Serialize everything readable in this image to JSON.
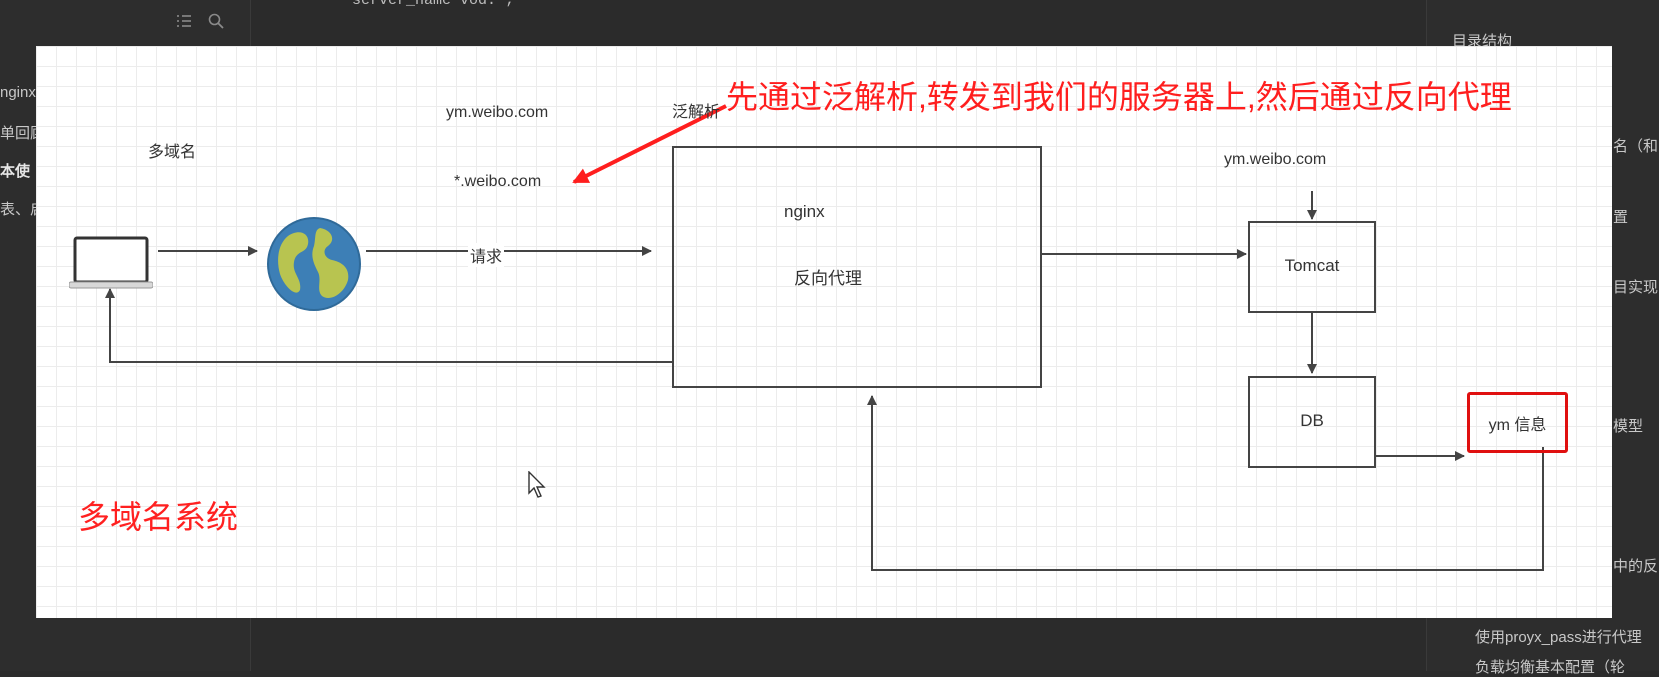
{
  "editor": {
    "top_code_line": "server_name vod. ;",
    "left_fragments": [
      "nginx",
      "单回顾",
      "本使",
      "表、启"
    ],
    "right_fragments": {
      "heading": "目录结构",
      "item1": "名（和",
      "item2": "置",
      "item3": "目实现",
      "item4": "模型",
      "item5": "中的反",
      "item6": "使用proyx_pass进行代理",
      "item7": "负载均衡基本配置（轮"
    }
  },
  "diagram": {
    "title_annotation": "先通过泛解析,转发到我们的服务器上,然后通过反向代理",
    "subtitle": "多域名",
    "system_label": "多域名系统",
    "domain_top": "ym.weibo.com",
    "wildcard_domain": "*.weibo.com",
    "wildcard_label": "泛解析",
    "request_label": "请求",
    "nginx_label": "nginx",
    "reverse_proxy_label": "反向代理",
    "tomcat_domain": "ym.weibo.com",
    "tomcat_label": "Tomcat",
    "db_label": "DB",
    "info_label": "ym 信息"
  },
  "colors": {
    "annotation_red": "#ff1e1e",
    "box_stroke": "#444444"
  }
}
